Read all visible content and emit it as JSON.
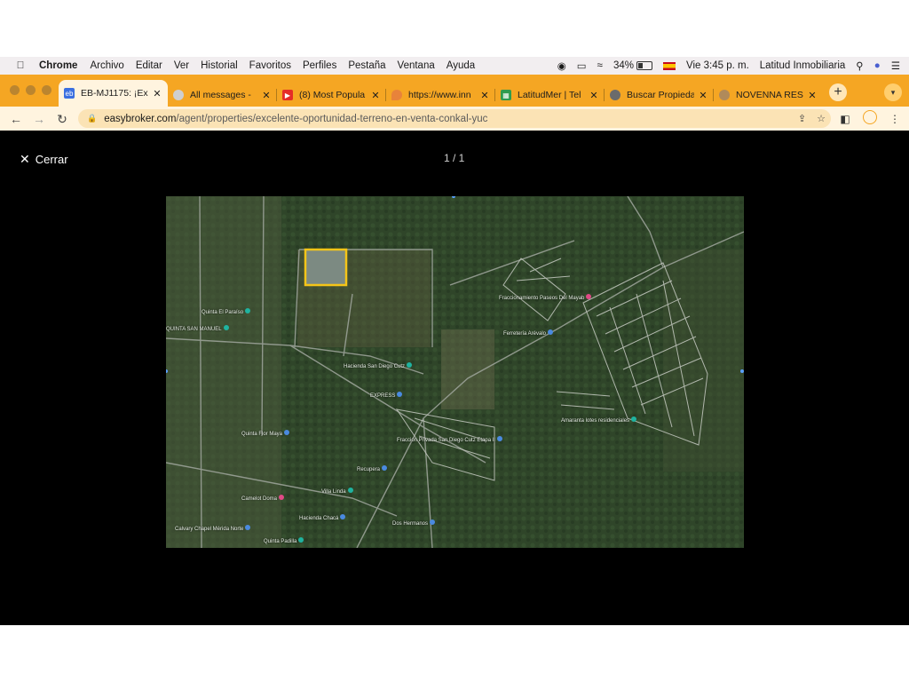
{
  "menubar": {
    "app_name": "Chrome",
    "items": [
      "Archivo",
      "Editar",
      "Ver",
      "Historial",
      "Favoritos",
      "Perfiles",
      "Pestaña",
      "Ventana",
      "Ayuda"
    ],
    "battery": "34%",
    "datetime": "Vie 3:45 p. m.",
    "user": "Latitud Inmobiliaria"
  },
  "tabs": [
    {
      "title": "EB-MJ1175: ¡Exc",
      "favicon_color": "#3a6fe0",
      "active": true
    },
    {
      "title": "All messages -",
      "favicon_color": "#9a9a9a",
      "active": false
    },
    {
      "title": "(8) Most Popula",
      "favicon_color": "#e52d27",
      "active": false
    },
    {
      "title": "https://www.inn",
      "favicon_color": "#e8833a",
      "active": false
    },
    {
      "title": "LatitudMer | Tel",
      "favicon_color": "#2e9b4e",
      "active": false
    },
    {
      "title": "Buscar Propieda",
      "favicon_color": "#6b6b6b",
      "active": false
    },
    {
      "title": "NOVENNA RESI",
      "favicon_color": "#b08a5a",
      "active": false
    }
  ],
  "toolbar": {
    "url_domain": "easybroker.com",
    "url_path": "/agent/properties/excelente-oportunidad-terreno-en-venta-conkal-yuc"
  },
  "viewer": {
    "close_label": "Cerrar",
    "counter": "1 / 1"
  },
  "map": {
    "labels": [
      {
        "text": "Quinta El Paraíso",
        "pin": "g"
      },
      {
        "text": "QUINTA SAN MANUEL",
        "pin": "g"
      },
      {
        "text": "Hacienda San Diego Cutz",
        "pin": "g"
      },
      {
        "text": "Fraccionamiento Paseos Del Mayab",
        "pin": "p"
      },
      {
        "text": "Ferretería Arévalo",
        "pin": "b"
      },
      {
        "text": "Amaranta lotes residenciales",
        "pin": "g"
      },
      {
        "text": "Quinta Flor Maya",
        "pin": "b"
      },
      {
        "text": "Fracción Privada San Diego Cutz Etapa II",
        "pin": "b"
      },
      {
        "text": "Recupera",
        "pin": "b"
      },
      {
        "text": "Camelot Doma",
        "pin": "p"
      },
      {
        "text": "Hacienda Chacá",
        "pin": "b"
      },
      {
        "text": "Dos Hermanos",
        "pin": "b"
      },
      {
        "text": "Calvary Chapel Mérida Norte",
        "pin": "b"
      },
      {
        "text": "Quinta Padilla",
        "pin": "g"
      },
      {
        "text": "Villa Linda",
        "pin": "g"
      },
      {
        "text": "EXPRESS",
        "pin": "b"
      }
    ]
  }
}
